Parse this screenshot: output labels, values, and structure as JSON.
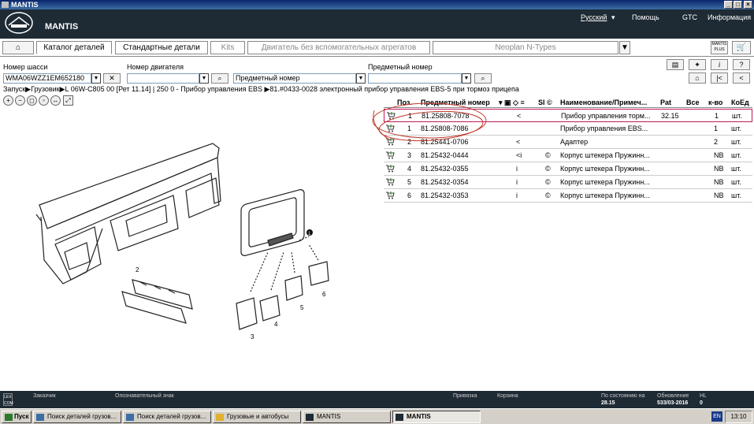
{
  "window": {
    "title": "MANTIS"
  },
  "header": {
    "app_name": "MANTIS",
    "language": "Русский",
    "help": "Помощь",
    "gtc": "GTC",
    "info": "Информация"
  },
  "tabs": [
    {
      "label": "Каталог деталей"
    },
    {
      "label": "Стандартные детали"
    },
    {
      "label": "Kits"
    },
    {
      "label": "Двигатель без вспомогательных агрегатов"
    },
    {
      "label": "Neoplan N-Types"
    }
  ],
  "mantis_plus": "MANTIS PLUS",
  "search": {
    "chassis_label": "Номер шасси",
    "chassis_value": "WMA06WZZ1EM652180",
    "engine_label": "Номер двигателя",
    "engine_value": "",
    "part_label": "Предметный номер",
    "part_type_value": "Предметный номер",
    "part_value": ""
  },
  "breadcrumb": "Запуск▶Грузовик▶L 06W-C805 00  [Рет 11.14]  | 250 0 - Прибор управления  EBS ▶81.#0433-0028  электронный прибор управления EBS-5 при тормоз прицепа",
  "zoom_icons": [
    "zoom-in-icon",
    "zoom-out-icon",
    "zoom-fit-icon",
    "zoom-area-icon",
    "zoom-width-icon",
    "fullscreen-icon"
  ],
  "table": {
    "headers": {
      "pos": "Поз.",
      "number": "Предметный номер",
      "si": "SI",
      "name": "Наименование/Примеч...",
      "pat": "Pat",
      "all": "Все",
      "qty": "к-во",
      "unit": "КоЕд"
    },
    "rows": [
      {
        "pos": "1",
        "number": "81.25808-7078",
        "flag": "<",
        "info": "",
        "name": "Прибор управления торм...",
        "pat": "32.15",
        "qty": "1",
        "unit": "шт."
      },
      {
        "pos": "1",
        "number": "81.25808-7086",
        "flag": "",
        "info": "",
        "name": "Прибор управления   EBS...",
        "pat": "",
        "qty": "1",
        "unit": "шт."
      },
      {
        "pos": "2",
        "number": "81.25441-0706",
        "flag": "<",
        "info": "",
        "name": "Адаптер",
        "pat": "",
        "qty": "2",
        "unit": "шт."
      },
      {
        "pos": "3",
        "number": "81.25432-0444",
        "flag": "<i",
        "info": "©",
        "name": "Корпус штекера Пружинн...",
        "pat": "",
        "qty": "NB",
        "unit": "шт."
      },
      {
        "pos": "4",
        "number": "81.25432-0355",
        "flag": "i",
        "info": "©",
        "name": "Корпус штекера Пружинн...",
        "pat": "",
        "qty": "NB",
        "unit": "шт."
      },
      {
        "pos": "5",
        "number": "81.25432-0354",
        "flag": "i",
        "info": "©",
        "name": "Корпус штекера Пружинн...",
        "pat": "",
        "qty": "NB",
        "unit": "шт."
      },
      {
        "pos": "6",
        "number": "81.25432-0353",
        "flag": "i",
        "info": "©",
        "name": "Корпус штекера Пружинн...",
        "pat": "",
        "qty": "NB",
        "unit": "шт."
      }
    ]
  },
  "diagram_labels": {
    "l1": "1",
    "l2": "2",
    "l3": "3",
    "l4": "4",
    "l5": "5",
    "l6": "6"
  },
  "status": {
    "customer": "Заказчик",
    "mark": "Опознавательный знак",
    "binding": "Привязка",
    "cart": "Корзина",
    "as_of_label": "По состоянию на",
    "as_of_value": "28.15",
    "update_label": "Обновление",
    "update_value": "533/03-2016",
    "hl_label": "HL",
    "hl_value": "0"
  },
  "taskbar": {
    "start": "Пуск",
    "items": [
      "Поиск деталей грузов...",
      "Поиск деталей грузов...",
      "Грузовые и автобусы",
      "MANTIS",
      "MANTIS"
    ],
    "lang": "EN",
    "clock": "13:10"
  }
}
